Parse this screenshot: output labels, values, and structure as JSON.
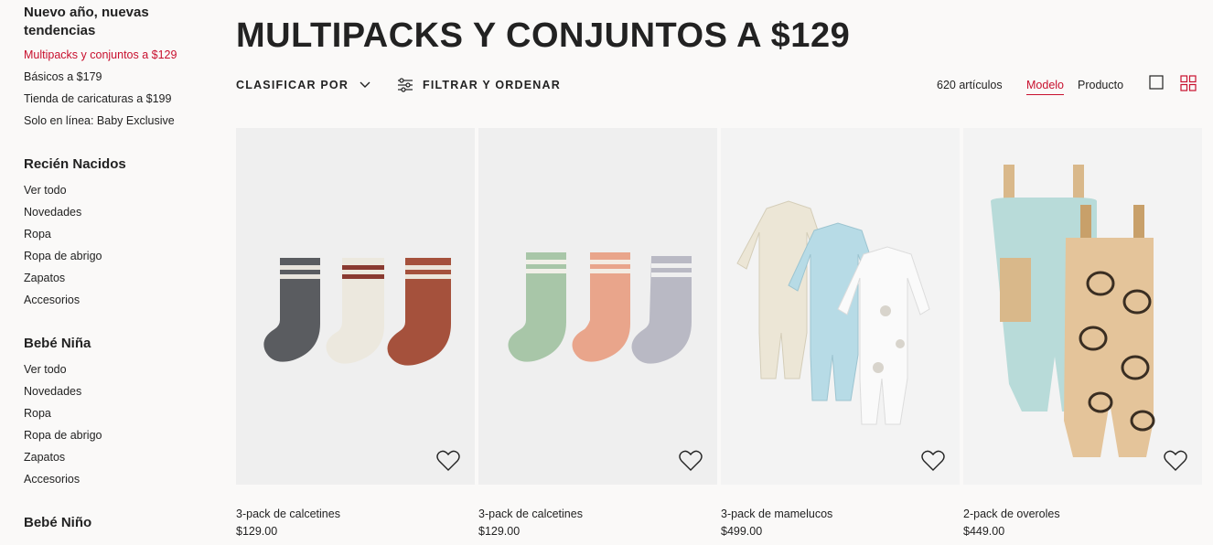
{
  "sidebar": {
    "groups": [
      {
        "heading": "Nuevo año, nuevas tendencias",
        "items": [
          "Multipacks y conjuntos a $129",
          "Básicos a $179",
          "Tienda de caricaturas a $199",
          "Solo en línea: Baby Exclusive"
        ]
      },
      {
        "heading": "Recién Nacidos",
        "items": [
          "Ver todo",
          "Novedades",
          "Ropa",
          "Ropa de abrigo",
          "Zapatos",
          "Accesorios"
        ]
      },
      {
        "heading": "Bebé Niña",
        "items": [
          "Ver todo",
          "Novedades",
          "Ropa",
          "Ropa de abrigo",
          "Zapatos",
          "Accesorios"
        ]
      },
      {
        "heading": "Bebé Niño",
        "items": []
      }
    ]
  },
  "page": {
    "title": "MULTIPACKS Y CONJUNTOS A $129"
  },
  "toolbar": {
    "sort_label": "CLASIFICAR POR",
    "filter_label": "FILTRAR Y ORDENAR",
    "count": "620 artículos",
    "view_model": "Modelo",
    "view_product": "Producto"
  },
  "products": [
    {
      "name": "3-pack de calcetines",
      "price": "$129.00",
      "icon": "heart-icon"
    },
    {
      "name": "3-pack de calcetines",
      "price": "$129.00",
      "icon": "heart-icon"
    },
    {
      "name": "3-pack de mamelucos",
      "price": "$499.00",
      "icon": "heart-icon"
    },
    {
      "name": "2-pack de overoles",
      "price": "$449.00",
      "icon": "heart-icon"
    }
  ],
  "colors": {
    "accent": "#c8102e",
    "text": "#222222",
    "background": "#faf9f8"
  }
}
